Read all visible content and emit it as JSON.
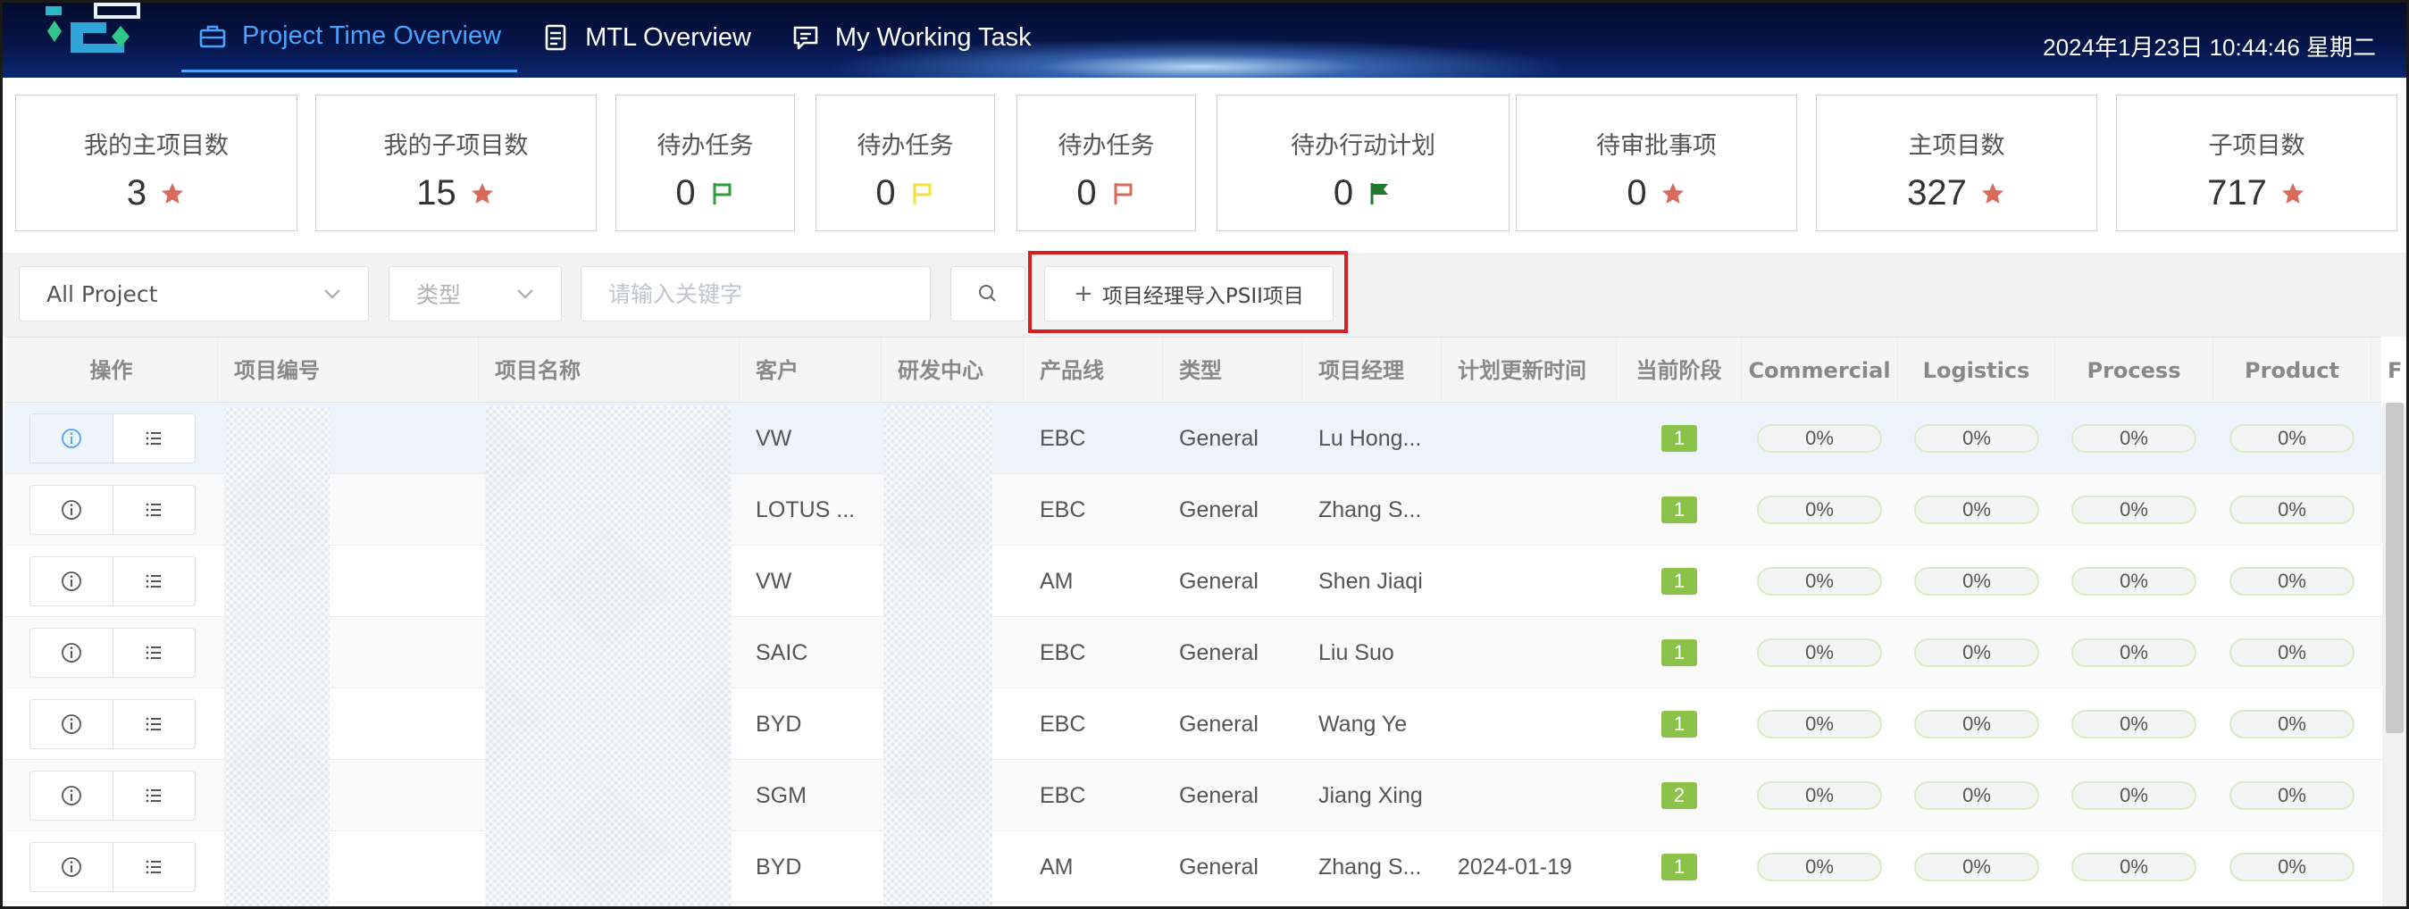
{
  "header": {
    "logo_icon": "company-logo",
    "nav": [
      {
        "label": "Project Time Overview",
        "icon": "briefcase-icon",
        "active": true
      },
      {
        "label": "MTL Overview",
        "icon": "document-icon",
        "active": false
      },
      {
        "label": "My Working Task",
        "icon": "chat-icon",
        "active": false
      }
    ],
    "datetime": "2024年1月23日  10:44:46  星期二"
  },
  "stats": [
    {
      "label": "我的主项目数",
      "value": "3",
      "icon": "star-icon",
      "color": "#d86b5c"
    },
    {
      "label": "我的子项目数",
      "value": "15",
      "icon": "star-icon",
      "color": "#d86b5c"
    },
    {
      "label": "待办任务",
      "value": "0",
      "icon": "flag-outline-icon",
      "color": "#2e9c3e"
    },
    {
      "label": "待办任务",
      "value": "0",
      "icon": "flag-outline-icon",
      "color": "#f2e23a"
    },
    {
      "label": "待办任务",
      "value": "0",
      "icon": "flag-outline-icon",
      "color": "#d86b5c"
    },
    {
      "label": "待办行动计划",
      "value": "0",
      "icon": "flag-filled-icon",
      "color": "#1f7a2d"
    },
    {
      "label": "待审批事项",
      "value": "0",
      "icon": "star-icon",
      "color": "#d86b5c"
    },
    {
      "label": "主项目数",
      "value": "327",
      "icon": "star-icon",
      "color": "#d86b5c"
    },
    {
      "label": "子项目数",
      "value": "717",
      "icon": "star-icon",
      "color": "#d86b5c"
    }
  ],
  "filters": {
    "project_select": "All Project",
    "type_select_placeholder": "类型",
    "search_placeholder": "请输入关键字",
    "import_button": "项目经理导入PSII项目",
    "import_icon": "plus-icon",
    "search_icon": "search-icon"
  },
  "table": {
    "headers": [
      "操作",
      "项目编号",
      "项目名称",
      "客户",
      "研发中心",
      "产品线",
      "类型",
      "项目经理",
      "计划更新时间",
      "当前阶段",
      "Commercial",
      "Logistics",
      "Process",
      "Product",
      "F"
    ],
    "rows": [
      {
        "customer": "VW",
        "product_line": "EBC",
        "type": "General",
        "manager": "Lu Hong...",
        "updated": "",
        "stage": "1",
        "commercial": "0%",
        "logistics": "0%",
        "process": "0%",
        "product": "0%"
      },
      {
        "customer": "LOTUS ...",
        "product_line": "EBC",
        "type": "General",
        "manager": "Zhang S...",
        "updated": "",
        "stage": "1",
        "commercial": "0%",
        "logistics": "0%",
        "process": "0%",
        "product": "0%"
      },
      {
        "customer": "VW",
        "product_line": "AM",
        "type": "General",
        "manager": "Shen Jiaqi",
        "updated": "",
        "stage": "1",
        "commercial": "0%",
        "logistics": "0%",
        "process": "0%",
        "product": "0%"
      },
      {
        "customer": "SAIC",
        "product_line": "EBC",
        "type": "General",
        "manager": "Liu Suo",
        "updated": "",
        "stage": "1",
        "commercial": "0%",
        "logistics": "0%",
        "process": "0%",
        "product": "0%"
      },
      {
        "customer": "BYD",
        "product_line": "EBC",
        "type": "General",
        "manager": "Wang Ye",
        "updated": "",
        "stage": "1",
        "commercial": "0%",
        "logistics": "0%",
        "process": "0%",
        "product": "0%"
      },
      {
        "customer": "SGM",
        "product_line": "EBC",
        "type": "General",
        "manager": "Jiang Xing",
        "updated": "",
        "stage": "2",
        "commercial": "0%",
        "logistics": "0%",
        "process": "0%",
        "product": "0%"
      },
      {
        "customer": "BYD",
        "product_line": "AM",
        "type": "General",
        "manager": "Zhang S...",
        "updated": "2024-01-19",
        "stage": "1",
        "commercial": "0%",
        "logistics": "0%",
        "process": "0%",
        "product": "0%"
      }
    ]
  },
  "colors": {
    "accent": "#4aa3ff",
    "stage_badge": "#8bc34a",
    "highlight_box": "#d81e1e",
    "header_bg": "#06154a"
  }
}
